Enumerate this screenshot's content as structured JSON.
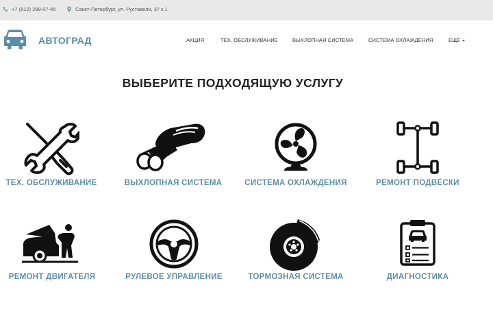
{
  "topbar": {
    "phone": "+7 (812) 299-07-45",
    "address": "Санкт-Петербург, ул. Руставели, 37 к.1",
    "phone_icon": "phone-icon",
    "address_icon": "map-pin-icon"
  },
  "header": {
    "logo_icon": "car-icon",
    "logo_text": "АВТОГРАД",
    "nav": [
      {
        "label": "АКЦИЯ"
      },
      {
        "label": "ТЕХ. ОБСЛУЖИВАНИЕ"
      },
      {
        "label": "ВЫХЛОПНАЯ СИСТЕМА"
      },
      {
        "label": "СИСТЕМА ОХЛАЖДЕНИЯ"
      },
      {
        "label": "ЕЩЕ"
      }
    ]
  },
  "main": {
    "title": "ВЫБЕРИТЕ ПОДХОДЯЩУЮ УСЛУГУ",
    "services": [
      {
        "label": "ТЕХ. ОБСЛУЖИВАНИЕ",
        "icon": "wrench-screwdriver-icon"
      },
      {
        "label": "ВЫХЛОПНАЯ СИСТЕМА",
        "icon": "exhaust-muffler-icon"
      },
      {
        "label": "СИСТЕМА ОХЛАЖДЕНИЯ",
        "icon": "fan-icon"
      },
      {
        "label": "РЕМОНТ ПОДВЕСКИ",
        "icon": "chassis-icon"
      },
      {
        "label": "РЕМОНТ ДВИГАТЕЛЯ",
        "icon": "mechanic-car-icon"
      },
      {
        "label": "РУЛЕВОЕ УПРАВЛЕНИЕ",
        "icon": "steering-wheel-icon"
      },
      {
        "label": "ТОРМОЗНАЯ СИСТЕМА",
        "icon": "brake-disc-icon"
      },
      {
        "label": "ДИАГНОСТИКА",
        "icon": "clipboard-icon"
      }
    ]
  },
  "colors": {
    "accent": "#5b8dab",
    "topbar_bg": "#e9e9e9",
    "text": "#222222"
  }
}
